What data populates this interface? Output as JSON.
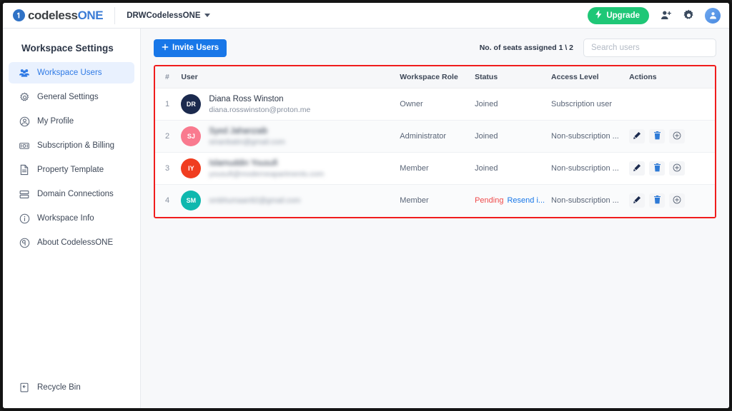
{
  "topbar": {
    "logo_mark": "1",
    "logo_text_1": "codeless",
    "logo_text_2": "ONE",
    "logo_icon": "codeless-one-logo-icon",
    "workspace_name": "DRWCodelessONE",
    "caret_icon": "chevron-down-icon",
    "upgrade_label": "Upgrade",
    "upgrade_icon": "lightning-bolt-icon",
    "upgrade_color": "#1fc777",
    "invite_people_icon": "add-person-icon",
    "settings_icon": "gear-icon",
    "account_icon": "user-avatar-icon"
  },
  "sidebar": {
    "title": "Workspace Settings",
    "items": [
      {
        "label": "Workspace Users",
        "icon": "users-group-icon",
        "active": true
      },
      {
        "label": "General Settings",
        "icon": "gear-icon",
        "active": false
      },
      {
        "label": "My Profile",
        "icon": "user-circle-icon",
        "active": false
      },
      {
        "label": "Subscription & Billing",
        "icon": "money-bill-icon",
        "active": false
      },
      {
        "label": "Property Template",
        "icon": "document-icon",
        "active": false
      },
      {
        "label": "Domain Connections",
        "icon": "server-stack-icon",
        "active": false
      },
      {
        "label": "Workspace Info",
        "icon": "info-circle-icon",
        "active": false
      },
      {
        "label": "About CodelessONE",
        "icon": "about-badge-icon",
        "active": false
      }
    ],
    "footer": {
      "label": "Recycle Bin",
      "icon": "recycle-bin-icon"
    },
    "active_color": "#2f7ae5",
    "active_bg": "#e9f1fe"
  },
  "toolbar": {
    "invite_label": "Invite Users",
    "invite_icon": "plus-icon",
    "invite_color": "#1877e8",
    "seats_text": "No. of seats assigned 1 \\ 2",
    "search_placeholder": "Search users",
    "search_value": ""
  },
  "table": {
    "highlight_color": "#f01d1d",
    "columns": [
      "#",
      "User",
      "Workspace Role",
      "Status",
      "Access Level",
      "Actions"
    ],
    "rows": [
      {
        "num": "1",
        "initials": "DR",
        "avatar_color": "#1b2a4e",
        "name": "Diana Ross Winston",
        "email": "diana.rosswinston@proton.me",
        "redacted": false,
        "role": "Owner",
        "status": "Joined",
        "status_resend": "",
        "access": "Subscription user",
        "has_actions": false
      },
      {
        "num": "2",
        "initials": "SJ",
        "avatar_color": "#f97a8f",
        "name": "Syed Jahanzaib",
        "email": "sinanbatin@gmail.com",
        "redacted": true,
        "role": "Administrator",
        "status": "Joined",
        "status_resend": "",
        "access": "Non-subscription ...",
        "has_actions": true
      },
      {
        "num": "3",
        "initials": "IY",
        "avatar_color": "#f03d20",
        "name": "Islamuddin Yousufi",
        "email": "yousufi@moderneapartments.com",
        "redacted": true,
        "role": "Member",
        "status": "Joined",
        "status_resend": "",
        "access": "Non-subscription ...",
        "has_actions": true
      },
      {
        "num": "4",
        "initials": "SM",
        "avatar_color": "#0fb8ae",
        "name": "",
        "email": "smbhumaan92@gmail.com",
        "redacted": true,
        "role": "Member",
        "status": "Pending",
        "status_resend": "Resend i...",
        "access": "Non-subscription ...",
        "has_actions": true
      }
    ],
    "action_icons": [
      "edit-pencil-icon",
      "delete-trash-icon",
      "add-circle-icon"
    ]
  }
}
